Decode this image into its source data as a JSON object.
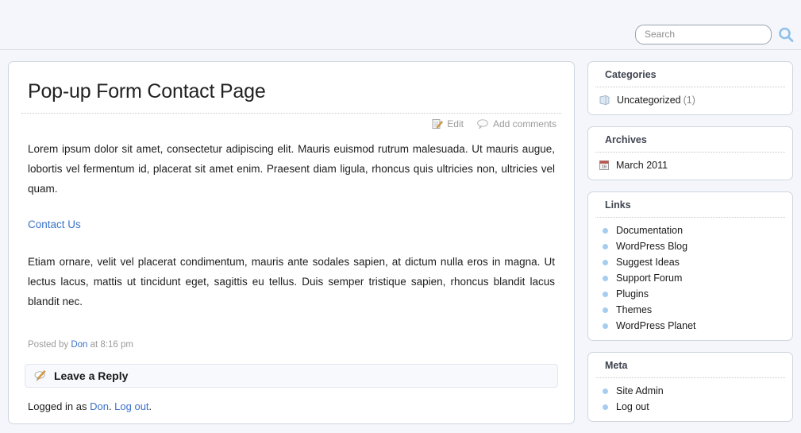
{
  "header": {
    "search": {
      "placeholder": "Search",
      "value": "",
      "icon": "search-icon"
    }
  },
  "main": {
    "title": "Pop-up Form Contact Page",
    "meta_actions": [
      {
        "label": "Edit",
        "icon": "edit-pencil-icon"
      },
      {
        "label": "Add comments",
        "icon": "comment-bubble-icon"
      }
    ],
    "paragraphs": [
      "Lorem ipsum dolor sit amet, consectetur adipiscing elit. Mauris euismod rutrum malesuada. Ut mauris augue, lobortis vel fermentum id, placerat sit amet enim. Praesent diam ligula, rhoncus quis ultricies non, ultricies vel quam.",
      "Etiam ornare, velit vel placerat condimentum, mauris ante sodales sapien, at dictum nulla eros in magna. Ut lectus lacus, mattis ut tincidunt eget, sagittis eu tellus. Duis semper tristique sapien, rhoncus blandit lacus blandit nec."
    ],
    "contact_link": "Contact Us",
    "posted": {
      "prefix": "Posted by ",
      "author": "Don",
      "suffix": " at 8:16 pm"
    },
    "reply": {
      "title": "Leave a Reply",
      "icon": "comment-pencil-icon",
      "logged_in_prefix": "Logged in as ",
      "logged_in_user": "Don",
      "logged_in_separator": ". ",
      "logout_label": "Log out",
      "logged_in_suffix": "."
    }
  },
  "sidebar": {
    "widgets": [
      {
        "title": "Categories",
        "style": "icon",
        "items": [
          {
            "label": "Uncategorized",
            "count": "(1)",
            "icon": "book-icon"
          }
        ]
      },
      {
        "title": "Archives",
        "style": "icon",
        "items": [
          {
            "label": "March 2011",
            "count": "",
            "icon": "calendar-icon"
          }
        ]
      },
      {
        "title": "Links",
        "style": "bullet",
        "items": [
          {
            "label": "Documentation",
            "count": "",
            "icon": "bullet-icon"
          },
          {
            "label": "WordPress Blog",
            "count": "",
            "icon": "bullet-icon"
          },
          {
            "label": "Suggest Ideas",
            "count": "",
            "icon": "bullet-icon"
          },
          {
            "label": "Support Forum",
            "count": "",
            "icon": "bullet-icon"
          },
          {
            "label": "Plugins",
            "count": "",
            "icon": "bullet-icon"
          },
          {
            "label": "Themes",
            "count": "",
            "icon": "bullet-icon"
          },
          {
            "label": "WordPress Planet",
            "count": "",
            "icon": "bullet-icon"
          }
        ]
      },
      {
        "title": "Meta",
        "style": "bullet",
        "items": [
          {
            "label": "Site Admin",
            "count": "",
            "icon": "bullet-icon"
          },
          {
            "label": "Log out",
            "count": "",
            "icon": "bullet-icon"
          }
        ]
      }
    ]
  },
  "colors": {
    "page_bg": "#f4f6fb",
    "box_border": "#cfd6e0",
    "link_blue": "#3a72c8",
    "bullet_blue": "#a6cdf0",
    "search_icon_blue": "#8fc0ea",
    "muted_text": "#9b9b9b"
  }
}
